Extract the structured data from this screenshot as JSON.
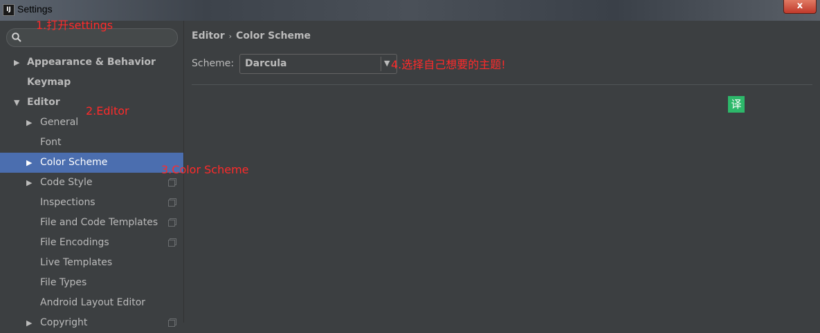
{
  "window": {
    "title": "Settings",
    "app_icon": "IJ",
    "close_label": "x"
  },
  "search": {
    "placeholder": ""
  },
  "tree": [
    {
      "label": "Appearance & Behavior",
      "arrow": "▶",
      "bold": true,
      "indent": 0,
      "copy": false,
      "selected": false
    },
    {
      "label": "Keymap",
      "arrow": "",
      "bold": true,
      "indent": 0,
      "copy": false,
      "selected": false
    },
    {
      "label": "Editor",
      "arrow": "▼",
      "bold": true,
      "indent": 0,
      "copy": false,
      "selected": false
    },
    {
      "label": "General",
      "arrow": "▶",
      "bold": false,
      "indent": 1,
      "copy": false,
      "selected": false
    },
    {
      "label": "Font",
      "arrow": "",
      "bold": false,
      "indent": 1,
      "copy": false,
      "selected": false
    },
    {
      "label": "Color Scheme",
      "arrow": "▶",
      "bold": false,
      "indent": 1,
      "copy": false,
      "selected": true
    },
    {
      "label": "Code Style",
      "arrow": "▶",
      "bold": false,
      "indent": 1,
      "copy": true,
      "selected": false
    },
    {
      "label": "Inspections",
      "arrow": "",
      "bold": false,
      "indent": 1,
      "copy": true,
      "selected": false
    },
    {
      "label": "File and Code Templates",
      "arrow": "",
      "bold": false,
      "indent": 1,
      "copy": true,
      "selected": false
    },
    {
      "label": "File Encodings",
      "arrow": "",
      "bold": false,
      "indent": 1,
      "copy": true,
      "selected": false
    },
    {
      "label": "Live Templates",
      "arrow": "",
      "bold": false,
      "indent": 1,
      "copy": false,
      "selected": false
    },
    {
      "label": "File Types",
      "arrow": "",
      "bold": false,
      "indent": 1,
      "copy": false,
      "selected": false
    },
    {
      "label": "Android Layout Editor",
      "arrow": "",
      "bold": false,
      "indent": 1,
      "copy": false,
      "selected": false
    },
    {
      "label": "Copyright",
      "arrow": "▶",
      "bold": false,
      "indent": 1,
      "copy": true,
      "selected": false
    }
  ],
  "breadcrumb": {
    "parent": "Editor",
    "separator": "›",
    "current": "Color Scheme"
  },
  "scheme": {
    "label": "Scheme:",
    "value": "Darcula",
    "arrow": "▼"
  },
  "translate_icon": "译",
  "annotations": {
    "a1": "1.打开settings",
    "a2": "2.Editor",
    "a3": "3.Color Scheme",
    "a4": "4.选择自己想要的主题!"
  },
  "colors": {
    "selection": "#4b6eaf",
    "annotation": "#ff2a2a",
    "background": "#3c3f41"
  }
}
